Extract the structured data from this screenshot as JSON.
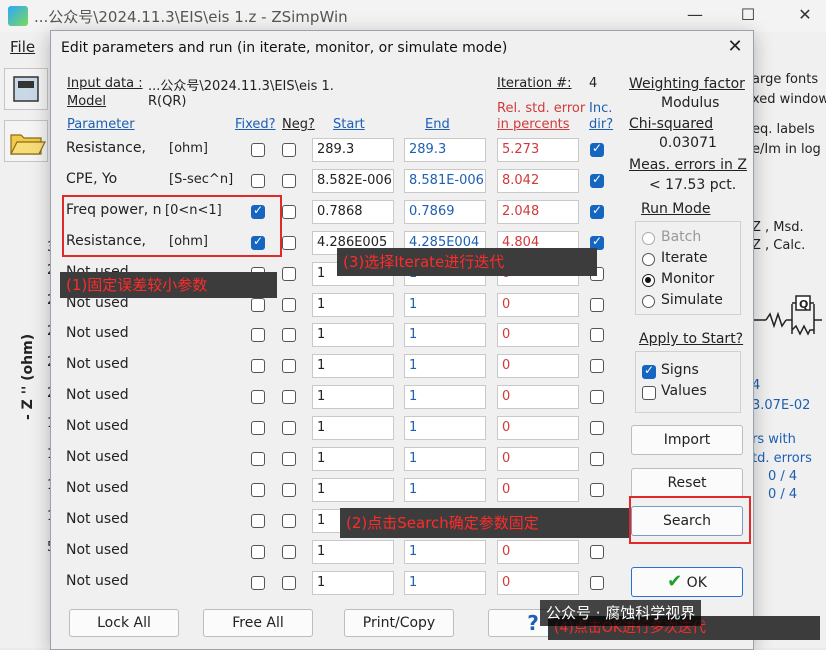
{
  "app": {
    "title": "...公众号\\2024.11.3\\EIS\\eis 1.z - ZSimpWin",
    "menu_file": "File",
    "minimize_icon": "—",
    "maximize_icon": "☐",
    "close_icon": "✕",
    "y_axis_label": "- Z '' (ohm)",
    "y_ticks": [
      "3",
      "2",
      "2",
      "2",
      "2",
      "2",
      "1",
      "1",
      "1",
      "1",
      "5"
    ],
    "right_panel": {
      "large_fonts": "arge fonts",
      "fixed_window": "xed window",
      "eq_labels": "eq. labels",
      "re_im_log": "e/Im in log",
      "msd": "Z , Msd.",
      "calc": "Z , Calc.",
      "iter_value": "4",
      "chi_value": "3.07E-02",
      "params_with": "rs with",
      "std_errors": "td. errors",
      "ratio1": "0 / 4",
      "ratio2": "0 / 4"
    }
  },
  "dialog": {
    "title": "Edit parameters and run (in iterate, monitor, or simulate mode)",
    "close_icon": "✕",
    "input_data_label": "Input data :",
    "input_data_value": "...公众号\\2024.11.3\\EIS\\eis 1.",
    "model_label": "Model",
    "model_value": "R(QR)",
    "iteration_label": "Iteration #:",
    "iteration_value": "4",
    "headers": {
      "parameter": "Parameter",
      "fixed": "Fixed?",
      "neg": "Neg?",
      "start": "Start",
      "end": "End",
      "rel_err_1": "Rel. std. error",
      "rel_err_2": "in percents",
      "inc_1": "Inc.",
      "inc_2": "dir?"
    },
    "rows": [
      {
        "label": "Resistance,",
        "unit": "[ohm]",
        "fixed": false,
        "neg": false,
        "start": "289.3",
        "end": "289.3",
        "err": "5.273",
        "inc": true
      },
      {
        "label": "CPE, Yo",
        "unit": "[S-sec^n]",
        "fixed": false,
        "neg": false,
        "start": "8.582E-006",
        "end": "8.581E-006",
        "err": "8.042",
        "inc": true
      },
      {
        "label": "Freq power, n",
        "unit": "[0<n<1]",
        "fixed": true,
        "neg": false,
        "start": "0.7868",
        "end": "0.7869",
        "err": "2.048",
        "inc": true
      },
      {
        "label": "Resistance,",
        "unit": "[ohm]",
        "fixed": true,
        "neg": false,
        "start": "4.286E005",
        "end": "4.285E004",
        "err": "4.804",
        "inc": true
      },
      {
        "label": "Not used",
        "unit": "",
        "fixed": false,
        "neg": false,
        "start": "1",
        "end": "1",
        "err": "0",
        "inc": false
      },
      {
        "label": "Not used",
        "unit": "",
        "fixed": false,
        "neg": false,
        "start": "1",
        "end": "1",
        "err": "0",
        "inc": false
      },
      {
        "label": "Not used",
        "unit": "",
        "fixed": false,
        "neg": false,
        "start": "1",
        "end": "1",
        "err": "0",
        "inc": false
      },
      {
        "label": "Not used",
        "unit": "",
        "fixed": false,
        "neg": false,
        "start": "1",
        "end": "1",
        "err": "0",
        "inc": false
      },
      {
        "label": "Not used",
        "unit": "",
        "fixed": false,
        "neg": false,
        "start": "1",
        "end": "1",
        "err": "0",
        "inc": false
      },
      {
        "label": "Not used",
        "unit": "",
        "fixed": false,
        "neg": false,
        "start": "1",
        "end": "1",
        "err": "0",
        "inc": false
      },
      {
        "label": "Not used",
        "unit": "",
        "fixed": false,
        "neg": false,
        "start": "1",
        "end": "1",
        "err": "0",
        "inc": false
      },
      {
        "label": "Not used",
        "unit": "",
        "fixed": false,
        "neg": false,
        "start": "1",
        "end": "1",
        "err": "0",
        "inc": false
      },
      {
        "label": "Not used",
        "unit": "",
        "fixed": false,
        "neg": false,
        "start": "1",
        "end": "1",
        "err": "0",
        "inc": false
      },
      {
        "label": "Not used",
        "unit": "",
        "fixed": false,
        "neg": false,
        "start": "1",
        "end": "1",
        "err": "0",
        "inc": false
      },
      {
        "label": "Not used",
        "unit": "",
        "fixed": false,
        "neg": false,
        "start": "1",
        "end": "1",
        "err": "0",
        "inc": false
      }
    ],
    "weighting": {
      "label": "Weighting factor",
      "value": "Modulus",
      "chi_label": "Chi-squared",
      "chi_value": "0.03071",
      "meas_label": "Meas. errors in Z",
      "meas_value": "< 17.53 pct."
    },
    "run_mode": {
      "label": "Run Mode",
      "options": [
        {
          "label": "Batch",
          "selected": false,
          "disabled": true
        },
        {
          "label": "Iterate",
          "selected": false,
          "disabled": false
        },
        {
          "label": "Monitor",
          "selected": true,
          "disabled": false
        },
        {
          "label": "Simulate",
          "selected": false,
          "disabled": false
        }
      ]
    },
    "apply": {
      "label": "Apply to Start?",
      "signs": "Signs",
      "signs_checked": true,
      "values": "Values",
      "values_checked": false
    },
    "buttons": {
      "import": "Import",
      "reset": "Reset",
      "search": "Search",
      "ok": "OK",
      "ok_icon": "✔",
      "lock_all": "Lock All",
      "free_all": "Free All",
      "print_copy": "Print/Copy",
      "help_icon": "?"
    }
  },
  "annotations": {
    "step1": "(1)固定误差较小参数",
    "step2": "(2)点击Search确定参数固定",
    "step3": "(3)选择Iterate进行迭代",
    "step4": "(4)点击OK进行多次迭代"
  },
  "watermark": "公众号 · 腐蚀科学视界",
  "colors": {
    "accent": "#1566c0",
    "error_red": "#d13a3a",
    "annotation_red": "#e02a2a",
    "value_blue": "#1d5fb3"
  }
}
